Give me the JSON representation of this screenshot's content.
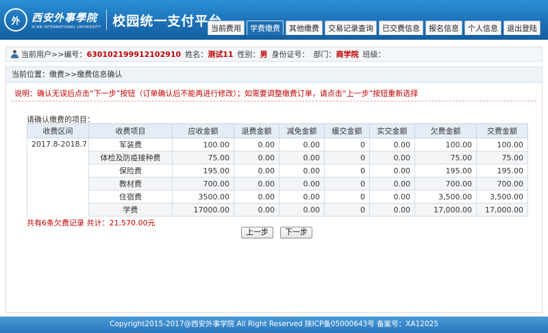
{
  "header": {
    "seal_glyph": "外",
    "school_name": "西安外事學院",
    "school_name_en": "XI'AN INTERNATIONAL UNIVERSITY",
    "platform_title": "校园统一支付平台",
    "nav": [
      {
        "label": "当前费用",
        "active": false
      },
      {
        "label": "学费缴费",
        "active": true
      },
      {
        "label": "其他缴费",
        "active": false
      },
      {
        "label": "交易记录查询",
        "active": false
      },
      {
        "label": "已交费信息",
        "active": false
      },
      {
        "label": "报名信息",
        "active": false
      },
      {
        "label": "个人信息",
        "active": false
      },
      {
        "label": "退出登陆",
        "active": false
      }
    ]
  },
  "user": {
    "prefix": "当前用户>>编号：",
    "id": "630102199912102910",
    "name_label": "姓名：",
    "name": "测试11",
    "gender_label": "性别：",
    "gender": "男",
    "idcard_label": "身份证号：",
    "idcard": "",
    "dept_label": "部门：",
    "dept": "商学院",
    "class_label": "班级："
  },
  "breadcrumb": "当前位置：缴费>>缴费信息确认",
  "notice": "说明：确认无误后点击“下一步”按钮（订单确认后不能再进行修改）；如需要调整缴费订单，请点击“上一步”按钮重新选择",
  "confirm_label": "请确认缴费的项目：",
  "table": {
    "headers": [
      "收费区间",
      "收费项目",
      "应收金额",
      "退费金额",
      "减免金额",
      "缓交金额",
      "实交金额",
      "欠费金额",
      "交费金额"
    ],
    "period": "2017.8-2018.7",
    "rows": [
      [
        "军装费",
        "100.00",
        "0.00",
        "0.00",
        "0",
        "0.00",
        "100.00",
        "100.00"
      ],
      [
        "体检及防疫接种费",
        "75.00",
        "0.00",
        "0.00",
        "0",
        "0.00",
        "75.00",
        "75.00"
      ],
      [
        "保险费",
        "195.00",
        "0.00",
        "0.00",
        "0",
        "0.00",
        "195.00",
        "195.00"
      ],
      [
        "教材费",
        "700.00",
        "0.00",
        "0.00",
        "0",
        "0.00",
        "700.00",
        "700.00"
      ],
      [
        "住宿费",
        "3500.00",
        "0.00",
        "0.00",
        "0",
        "0.00",
        "3,500.00",
        "3,500.00"
      ],
      [
        "学费",
        "17000.00",
        "0.00",
        "0.00",
        "0",
        "0.00",
        "17,000.00",
        "17,000.00"
      ]
    ]
  },
  "summary": "共有6条欠费记录  共计：21,570.00元",
  "buttons": {
    "prev": "上一步",
    "next": "下一步"
  },
  "footer": "Copyright2015-2017@西安外事学院   All Right Reserved   陕ICP备05000643号   备案号：XA12025",
  "colors": {
    "header_blue": "#1b6fb4",
    "alert_red": "#c00000"
  }
}
